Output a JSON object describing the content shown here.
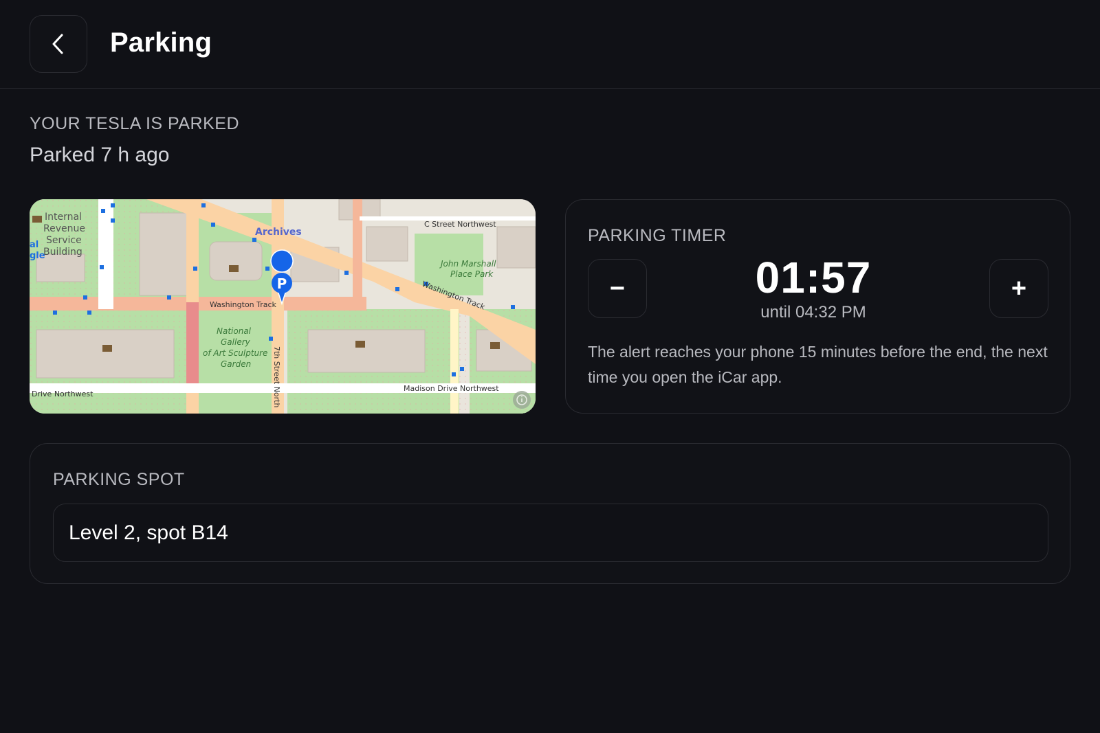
{
  "header": {
    "back_icon": "chevron-left-icon",
    "title": "Parking"
  },
  "status": {
    "heading": "YOUR TESLA IS PARKED",
    "parked_ago": "Parked 7 h ago"
  },
  "map": {
    "labels": {
      "irs_building": [
        "Internal",
        "Revenue",
        "Service",
        "Building"
      ],
      "archives": "Archives",
      "c_street": "C Street Northwest",
      "john_marshall": [
        "John Marshall",
        "Place Park"
      ],
      "washington_track_1": "Washington Track",
      "washington_track_2": "Washington Track",
      "sculpture_garden": [
        "National",
        "Gallery",
        "of Art Sculpture",
        "Garden"
      ],
      "seventh_street": "7th Street North",
      "madison_drive": "Madison Drive Northwest",
      "drive_northwest": "Drive Northwest",
      "edge_fragment": [
        "al",
        "gle"
      ]
    },
    "pin_label": "P",
    "pin_icon": "parking-pin-icon",
    "info_icon": "info-icon",
    "colors": {
      "land": "#e9e5dc",
      "park": "#b7dfa6",
      "building": "#d9d0c6",
      "road_major": "#f5b79a",
      "road_primary": "#fbd3a5",
      "pin": "#1565e8"
    }
  },
  "timer": {
    "label": "PARKING TIMER",
    "decrement_label": "−",
    "increment_label": "+",
    "value": "01:57",
    "until": "until 04:32 PM",
    "note": "The alert reaches your phone 15 minutes before the end, the next time you open the iCar app."
  },
  "spot": {
    "label": "PARKING SPOT",
    "value": "Level 2, spot B14"
  },
  "colors": {
    "background": "#101116",
    "card_border": "#2a2b31",
    "muted_text": "#b9bac0"
  }
}
